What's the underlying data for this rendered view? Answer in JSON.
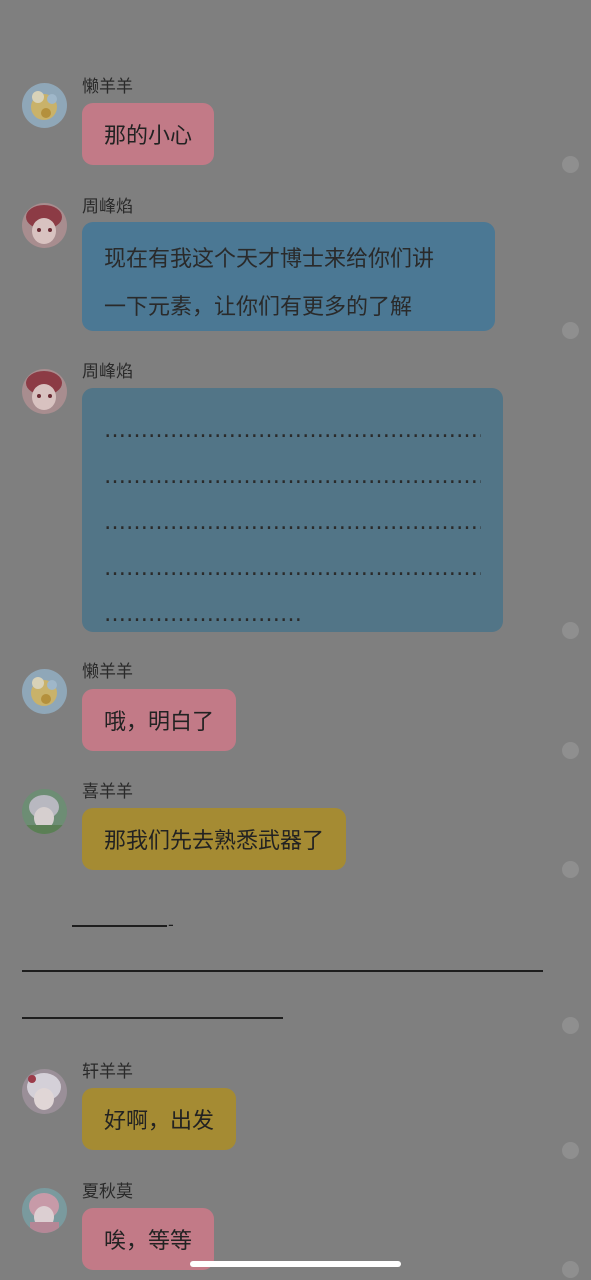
{
  "messages": [
    {
      "sender": "懒羊羊",
      "text": "那的小心"
    },
    {
      "sender": "周峰焰",
      "lines": [
        "现在有我这个天才博士来给你们讲",
        "一下元素，让你们有更多的了解"
      ]
    },
    {
      "sender": "周峰焰",
      "dot_lines": [
        "…………………………………………………",
        "…………………………………………………",
        "…………………………………………………",
        "…………………………………………………",
        "………………………"
      ]
    },
    {
      "sender": "懒羊羊",
      "text": "哦，明白了"
    },
    {
      "sender": "喜羊羊",
      "text": "那我们先去熟悉武器了"
    },
    {
      "sender": "轩羊羊",
      "text": "好啊，出发"
    },
    {
      "sender": "夏秋莫",
      "text": "唉，等等"
    }
  ],
  "separator": {
    "dash": "-"
  },
  "colors": {
    "background": "#7f7f7f",
    "bubble_pink": "#c27a87",
    "bubble_blue": "#4b7894",
    "bubble_gold": "#a58b33",
    "home_indicator": "#ffffff"
  },
  "icons": {
    "avatar_lanyangyang": "avatar-icon",
    "avatar_zhoufengyan": "avatar-icon",
    "avatar_xiyangyang": "avatar-icon",
    "avatar_xuanyangyang": "avatar-icon",
    "avatar_xiaqiumo": "avatar-icon"
  }
}
